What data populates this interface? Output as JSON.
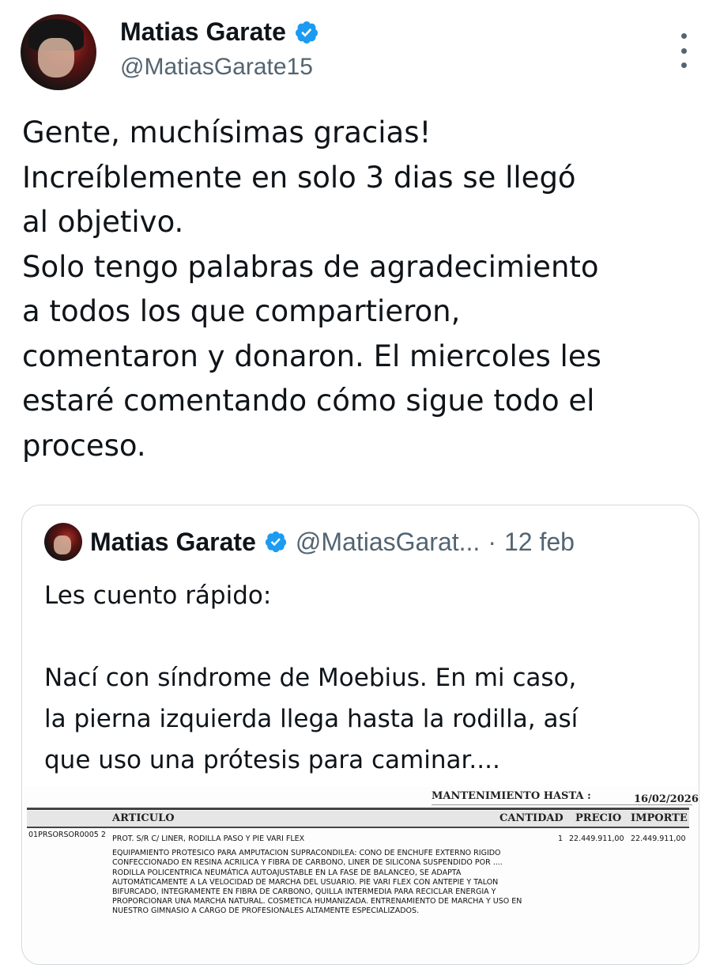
{
  "tweet": {
    "author_name": "Matias Garate",
    "handle": "@MatiasGarate15",
    "text": "Gente, muchísimas gracias!\nIncreíblemente en solo 3 dias se llegó\nal objetivo.\nSolo tengo palabras de agradecimiento\na todos los que compartieron,\ncomentaron y donaron. El miercoles les\nestaré comentando cómo sigue todo el\nproceso."
  },
  "quote": {
    "author_name": "Matias Garate",
    "handle": "@MatiasGarat...",
    "separator": "·",
    "date": "12 feb",
    "text": "Les cuento rápido:\n\nNací con síndrome de Moebius. En mi caso,\nla pierna izquierda llega hasta la rodilla, así\nque uso una prótesis para caminar...."
  },
  "document": {
    "maintenance_label": "MANTENIMIENTO HASTA :",
    "maintenance_date": "16/02/2026",
    "headers": {
      "article": "ARTICULO",
      "quantity": "CANTIDAD",
      "price": "PRECIO",
      "amount": "IMPORTE"
    },
    "row": {
      "code": "01PRSORSOR0005 2",
      "title": "PROT. S/R C/ LINER, RODILLA PASO Y PIE VARI FLEX",
      "description": "EQUIPAMIENTO PROTESICO PARA AMPUTACION SUPRACONDILEA: CONO DE ENCHUFE EXTERNO RIGIDO CONFECCIONADO EN RESINA ACRILICA Y FIBRA DE CARBONO, LINER DE SILICONA SUSPENDIDO POR .... RODILLA POLICENTRICA NEUMÁTICA AUTOAJUSTABLE EN LA FASE DE BALANCEO, SE ADAPTA AUTOMÁTICAMENTE A LA VELOCIDAD DE MARCHA DEL USUARIO. PIE VARI FLEX CON ANTEPIE Y TALON BIFURCADO, INTEGRAMENTE EN FIBRA DE CARBONO, QUILLA INTERMEDIA PARA RECICLAR ENERGIA Y PROPORCIONAR UNA MARCHA NATURAL. COSMETICA HUMANIZADA. ENTRENAMIENTO DE MARCHA Y USO EN NUESTRO GIMNASIO A CARGO DE PROFESIONALES ALTAMENTE ESPECIALIZADOS.",
      "quantity": "1",
      "price": "22.449.911,00",
      "amount": "22.449.911,00"
    }
  },
  "icons": {
    "verified": "verified-badge-icon",
    "more": "more-options-icon"
  },
  "colors": {
    "verified": "#1d9bf0",
    "secondary_text": "#536471",
    "border": "#cfd9de"
  }
}
